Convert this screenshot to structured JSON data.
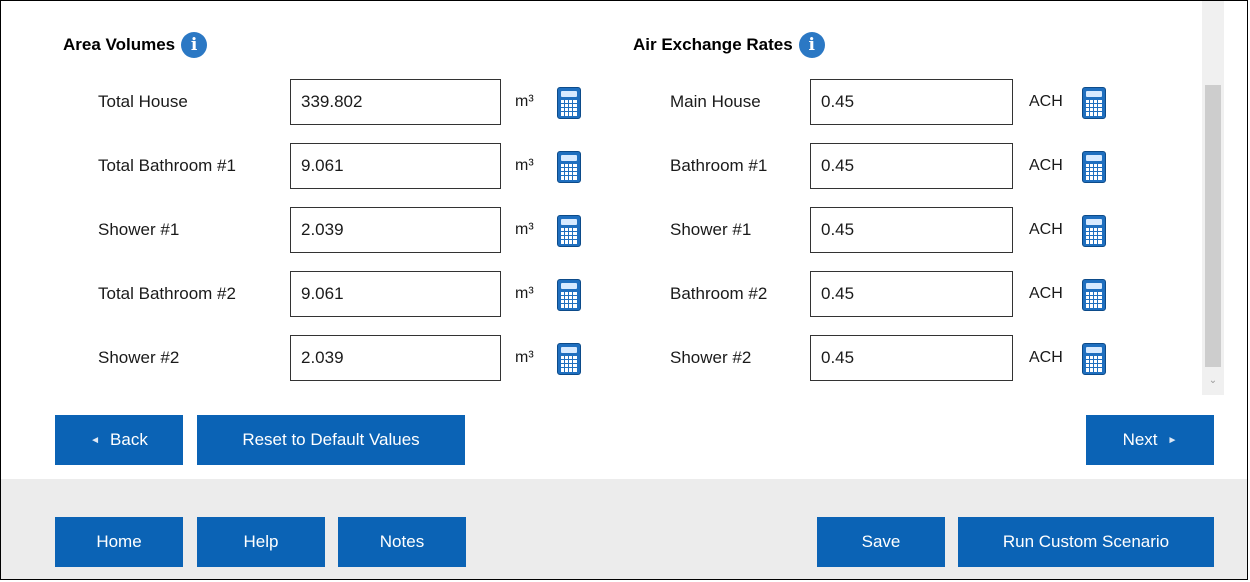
{
  "area_volumes": {
    "title": "Area Volumes",
    "info_icon": "i",
    "rows": [
      {
        "label": "Total House",
        "value": "339.802",
        "unit": "m³"
      },
      {
        "label": "Total Bathroom #1",
        "value": "9.061",
        "unit": "m³"
      },
      {
        "label": "Shower #1",
        "value": "2.039",
        "unit": "m³"
      },
      {
        "label": "Total Bathroom #2",
        "value": "9.061",
        "unit": "m³"
      },
      {
        "label": "Shower #2",
        "value": "2.039",
        "unit": "m³"
      }
    ]
  },
  "air_exchange": {
    "title": "Air Exchange Rates",
    "info_icon": "i",
    "rows": [
      {
        "label": "Main House",
        "value": "0.45",
        "unit": "ACH"
      },
      {
        "label": "Bathroom #1",
        "value": "0.45",
        "unit": "ACH"
      },
      {
        "label": "Shower #1",
        "value": "0.45",
        "unit": "ACH"
      },
      {
        "label": "Bathroom #2",
        "value": "0.45",
        "unit": "ACH"
      },
      {
        "label": "Shower #2",
        "value": "0.45",
        "unit": "ACH"
      }
    ]
  },
  "nav": {
    "back_label": "Back",
    "back_icon": "◄",
    "reset_label": "Reset to Default Values",
    "next_label": "Next",
    "next_icon": "►"
  },
  "footer": {
    "home_label": "Home",
    "help_label": "Help",
    "notes_label": "Notes",
    "save_label": "Save",
    "run_label": "Run Custom Scenario"
  },
  "scrollbar": {
    "down_arrow": "⌄"
  },
  "colors": {
    "button_blue": "#0b63b5",
    "info_blue": "#2b78c4",
    "footer_bg": "#ececec"
  }
}
